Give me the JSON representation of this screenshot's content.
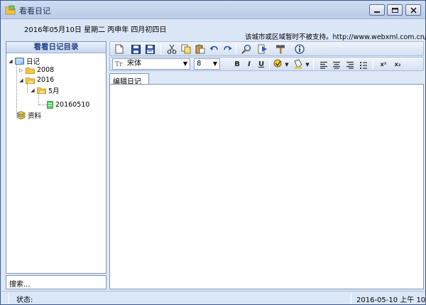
{
  "window": {
    "title": "看看日记"
  },
  "info": {
    "date_line": "2016年05月10日 星期二 丙申年 四月初四日",
    "notice": "该城市或区域暂时不被支持。http://www.webxml.com.cn/"
  },
  "sidebar": {
    "header": "看看日记目录",
    "tree": [
      {
        "label": "日记",
        "level": 0,
        "expanded": true,
        "icon": "diary-icon"
      },
      {
        "label": "2008",
        "level": 1,
        "expanded": false,
        "icon": "folder-icon"
      },
      {
        "label": "2016",
        "level": 1,
        "expanded": true,
        "icon": "folder-icon"
      },
      {
        "label": "5月",
        "level": 2,
        "expanded": true,
        "icon": "folder-icon"
      },
      {
        "label": "20160510",
        "level": 3,
        "icon": "note-icon"
      },
      {
        "label": "资料",
        "level": 0,
        "icon": "box-icon"
      }
    ],
    "search_value": "搜索..."
  },
  "toolbar": {
    "font_name": "宋体",
    "font_icon": "Tr",
    "font_size": "8",
    "bold": "B",
    "italic": "I",
    "underline": "U",
    "superscript": "x²",
    "subscript": "x₂"
  },
  "editor": {
    "tab_label": "编辑日记",
    "content": ""
  },
  "status": {
    "label": "状态:",
    "datetime": "2016-05-10 上午 10:"
  },
  "colors": {
    "window_bg": "#dfe8f6",
    "accent": "#1f3f8a",
    "folder": "#f5c842"
  }
}
